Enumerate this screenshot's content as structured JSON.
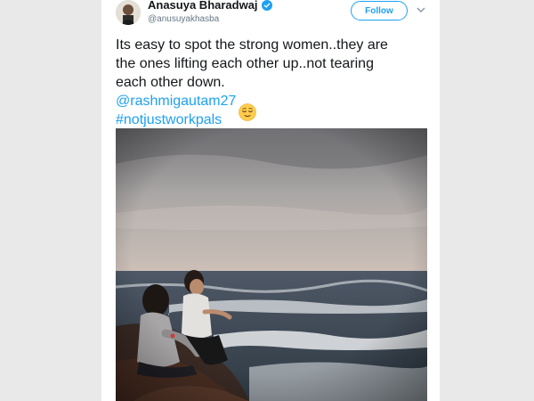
{
  "tweet": {
    "display_name": "Anasuya Bharadwaj",
    "handle": "@anusuyakhasba",
    "follow_label": "Follow",
    "text_lines": [
      "Its easy to spot the strong women..they are",
      "the ones lifting each other up..not tearing",
      "each other down."
    ],
    "mention": "@rashmigautam27",
    "hashtag": "#notjustworkpals",
    "emoji_icon": "relieved-face-emoji",
    "colors": {
      "link": "#1da1f2",
      "text": "#14171a",
      "muted": "#657786",
      "background": "#e9e9e9"
    }
  }
}
